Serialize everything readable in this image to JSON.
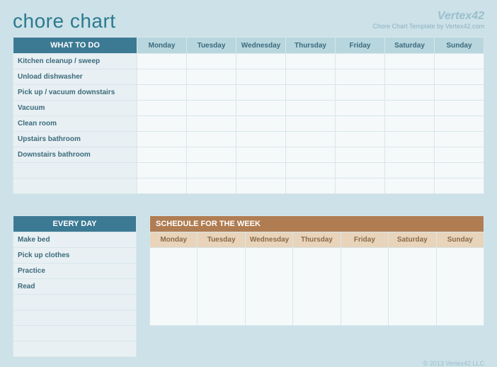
{
  "title": "chore chart",
  "brand": {
    "logo": "Vertex42",
    "sub": "Chore Chart Template by Vertex42.com"
  },
  "days": [
    "Monday",
    "Tuesday",
    "Wednesday",
    "Thursday",
    "Friday",
    "Saturday",
    "Sunday"
  ],
  "what_to_do_header": "WHAT TO DO",
  "chores": [
    "Kitchen cleanup / sweep",
    "Unload dishwasher",
    "Pick up / vacuum downstairs",
    "Vacuum",
    "Clean room",
    "Upstairs bathroom",
    "Downstairs bathroom",
    "",
    ""
  ],
  "every_day_header": "EVERY DAY",
  "every_day": [
    "Make bed",
    "Pick up clothes",
    "Practice",
    "Read",
    "",
    "",
    "",
    ""
  ],
  "schedule_header": "SCHEDULE FOR THE WEEK",
  "footer": "© 2013 Vertex42 LLC"
}
